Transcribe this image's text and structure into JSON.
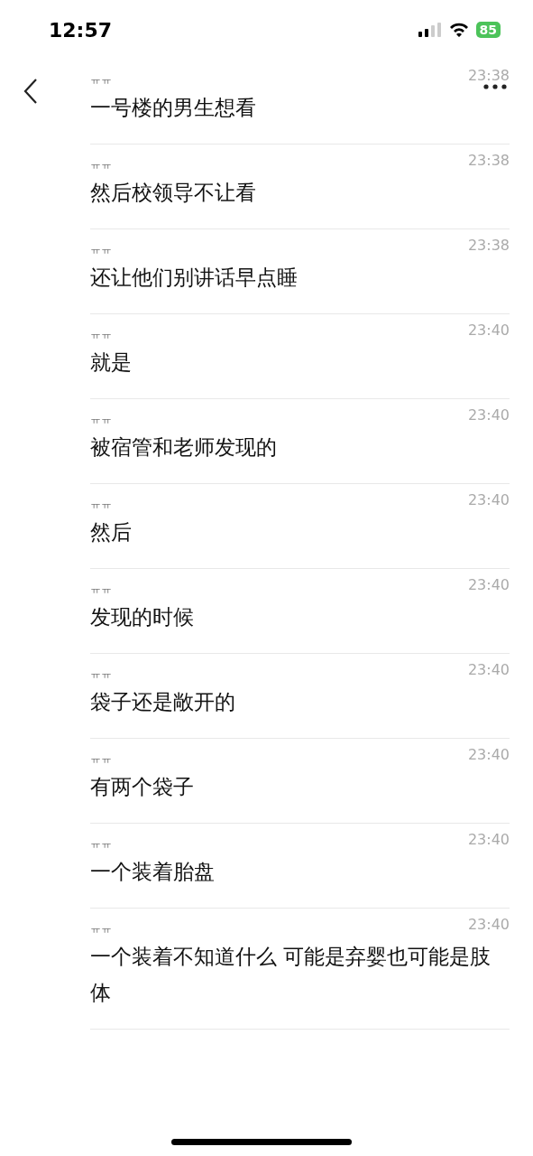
{
  "status_bar": {
    "time": "12:57",
    "battery": "85"
  },
  "messages": [
    {
      "sender": "ㅠㅠ",
      "time": "23:38",
      "text": "一号楼的男生想看"
    },
    {
      "sender": "ㅠㅠ",
      "time": "23:38",
      "text": "然后校领导不让看"
    },
    {
      "sender": "ㅠㅠ",
      "time": "23:38",
      "text": "还让他们别讲话早点睡"
    },
    {
      "sender": "ㅠㅠ",
      "time": "23:40",
      "text": "就是"
    },
    {
      "sender": "ㅠㅠ",
      "time": "23:40",
      "text": "被宿管和老师发现的"
    },
    {
      "sender": "ㅠㅠ",
      "time": "23:40",
      "text": "然后"
    },
    {
      "sender": "ㅠㅠ",
      "time": "23:40",
      "text": "发现的时候"
    },
    {
      "sender": "ㅠㅠ",
      "time": "23:40",
      "text": "袋子还是敞开的"
    },
    {
      "sender": "ㅠㅠ",
      "time": "23:40",
      "text": "有两个袋子"
    },
    {
      "sender": "ㅠㅠ",
      "time": "23:40",
      "text": "一个装着胎盘"
    },
    {
      "sender": "ㅠㅠ",
      "time": "23:40",
      "text": "一个装着不知道什么 可能是弃婴也可能是肢体"
    }
  ]
}
